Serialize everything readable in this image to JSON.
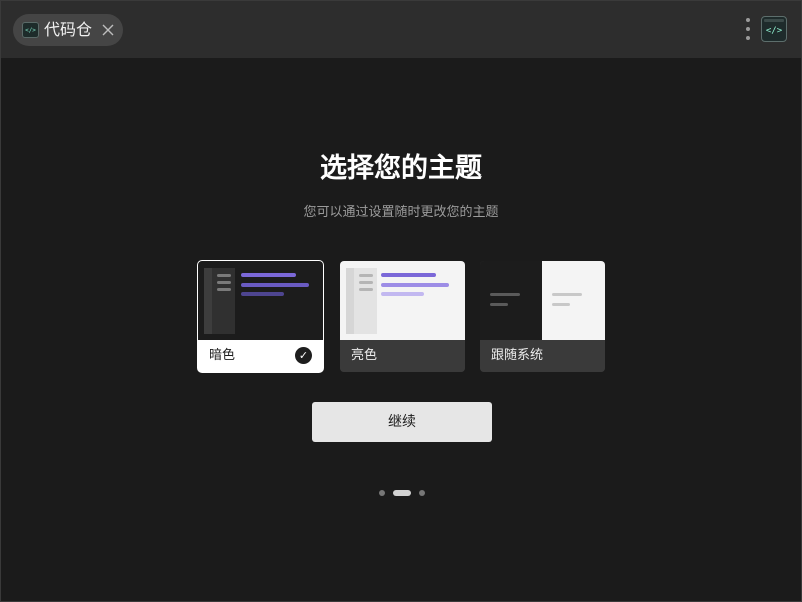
{
  "tab": {
    "title": "代码仓",
    "icon": "code-icon"
  },
  "titlebar": {
    "menu_icon": "more-vertical-icon",
    "app_icon": "code-terminal-icon"
  },
  "onboarding": {
    "title": "选择您的主题",
    "subtitle": "您可以通过设置随时更改您的主题",
    "themes": [
      {
        "label": "暗色",
        "selected": true
      },
      {
        "label": "亮色",
        "selected": false
      },
      {
        "label": "跟随系统",
        "selected": false
      }
    ],
    "continue_label": "继续",
    "pager": {
      "pages": 3,
      "current": 2
    }
  },
  "colors": {
    "background": "#1b1b1b",
    "titlebar": "#2d2d2d",
    "accent_purple": "#7b68d8",
    "button": "#e6e6e6"
  }
}
